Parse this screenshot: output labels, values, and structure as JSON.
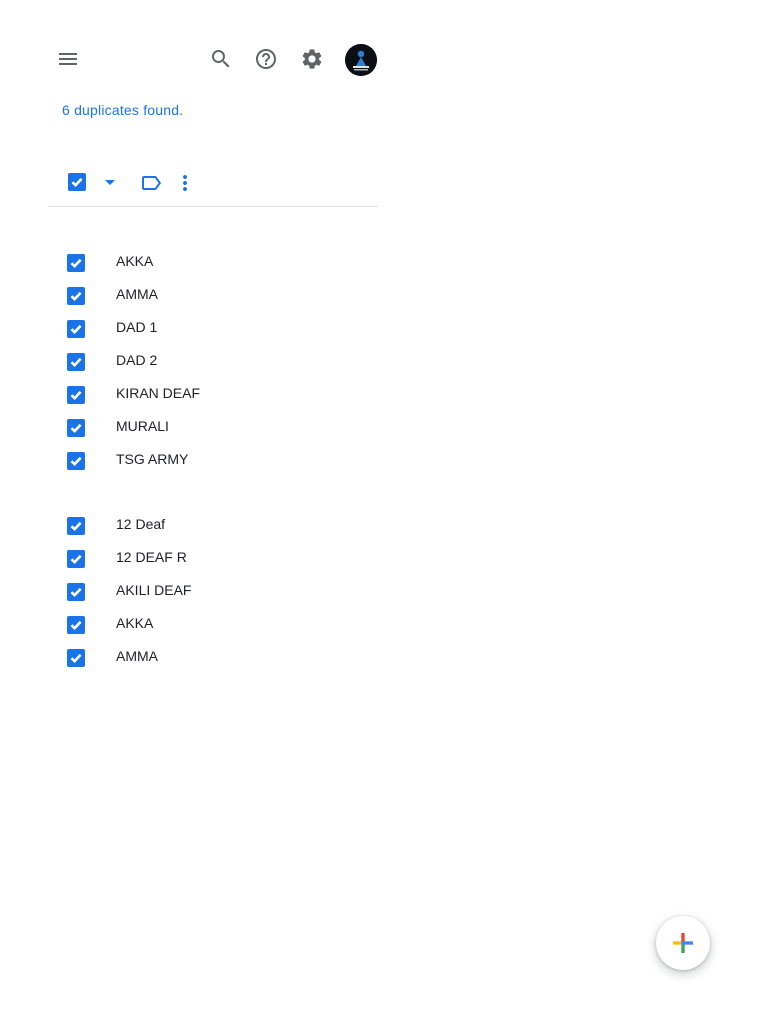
{
  "header": {
    "menu_icon": "hamburger-menu-icon",
    "search_icon": "search-icon",
    "help_icon": "help-icon",
    "settings_icon": "gear-icon",
    "avatar": "profile-avatar"
  },
  "status": {
    "message": "6 duplicates found."
  },
  "toolbar": {
    "select_all_checked": true,
    "dropdown_icon": "caret-down-icon",
    "label_icon": "label-icon",
    "more_icon": "more-vertical-icon"
  },
  "groups": [
    {
      "items": [
        {
          "name": "AKKA",
          "checked": true
        },
        {
          "name": "AMMA",
          "checked": true
        },
        {
          "name": "DAD 1",
          "checked": true
        },
        {
          "name": "DAD 2",
          "checked": true
        },
        {
          "name": "KIRAN DEAF",
          "checked": true
        },
        {
          "name": "MURALI",
          "checked": true
        },
        {
          "name": "TSG ARMY",
          "checked": true
        }
      ]
    },
    {
      "items": [
        {
          "name": "12 Deaf",
          "checked": true
        },
        {
          "name": "12 DEAF R",
          "checked": true
        },
        {
          "name": "AKILI DEAF",
          "checked": true
        },
        {
          "name": "AKKA",
          "checked": true
        },
        {
          "name": "AMMA",
          "checked": true
        }
      ]
    }
  ],
  "fab": {
    "icon": "plus-icon",
    "colors": [
      "#4285f4",
      "#ea4335",
      "#fbbc04",
      "#34a853"
    ]
  },
  "colors": {
    "accent": "#1a73e8",
    "text": "#202124",
    "icon": "#5f6368"
  }
}
